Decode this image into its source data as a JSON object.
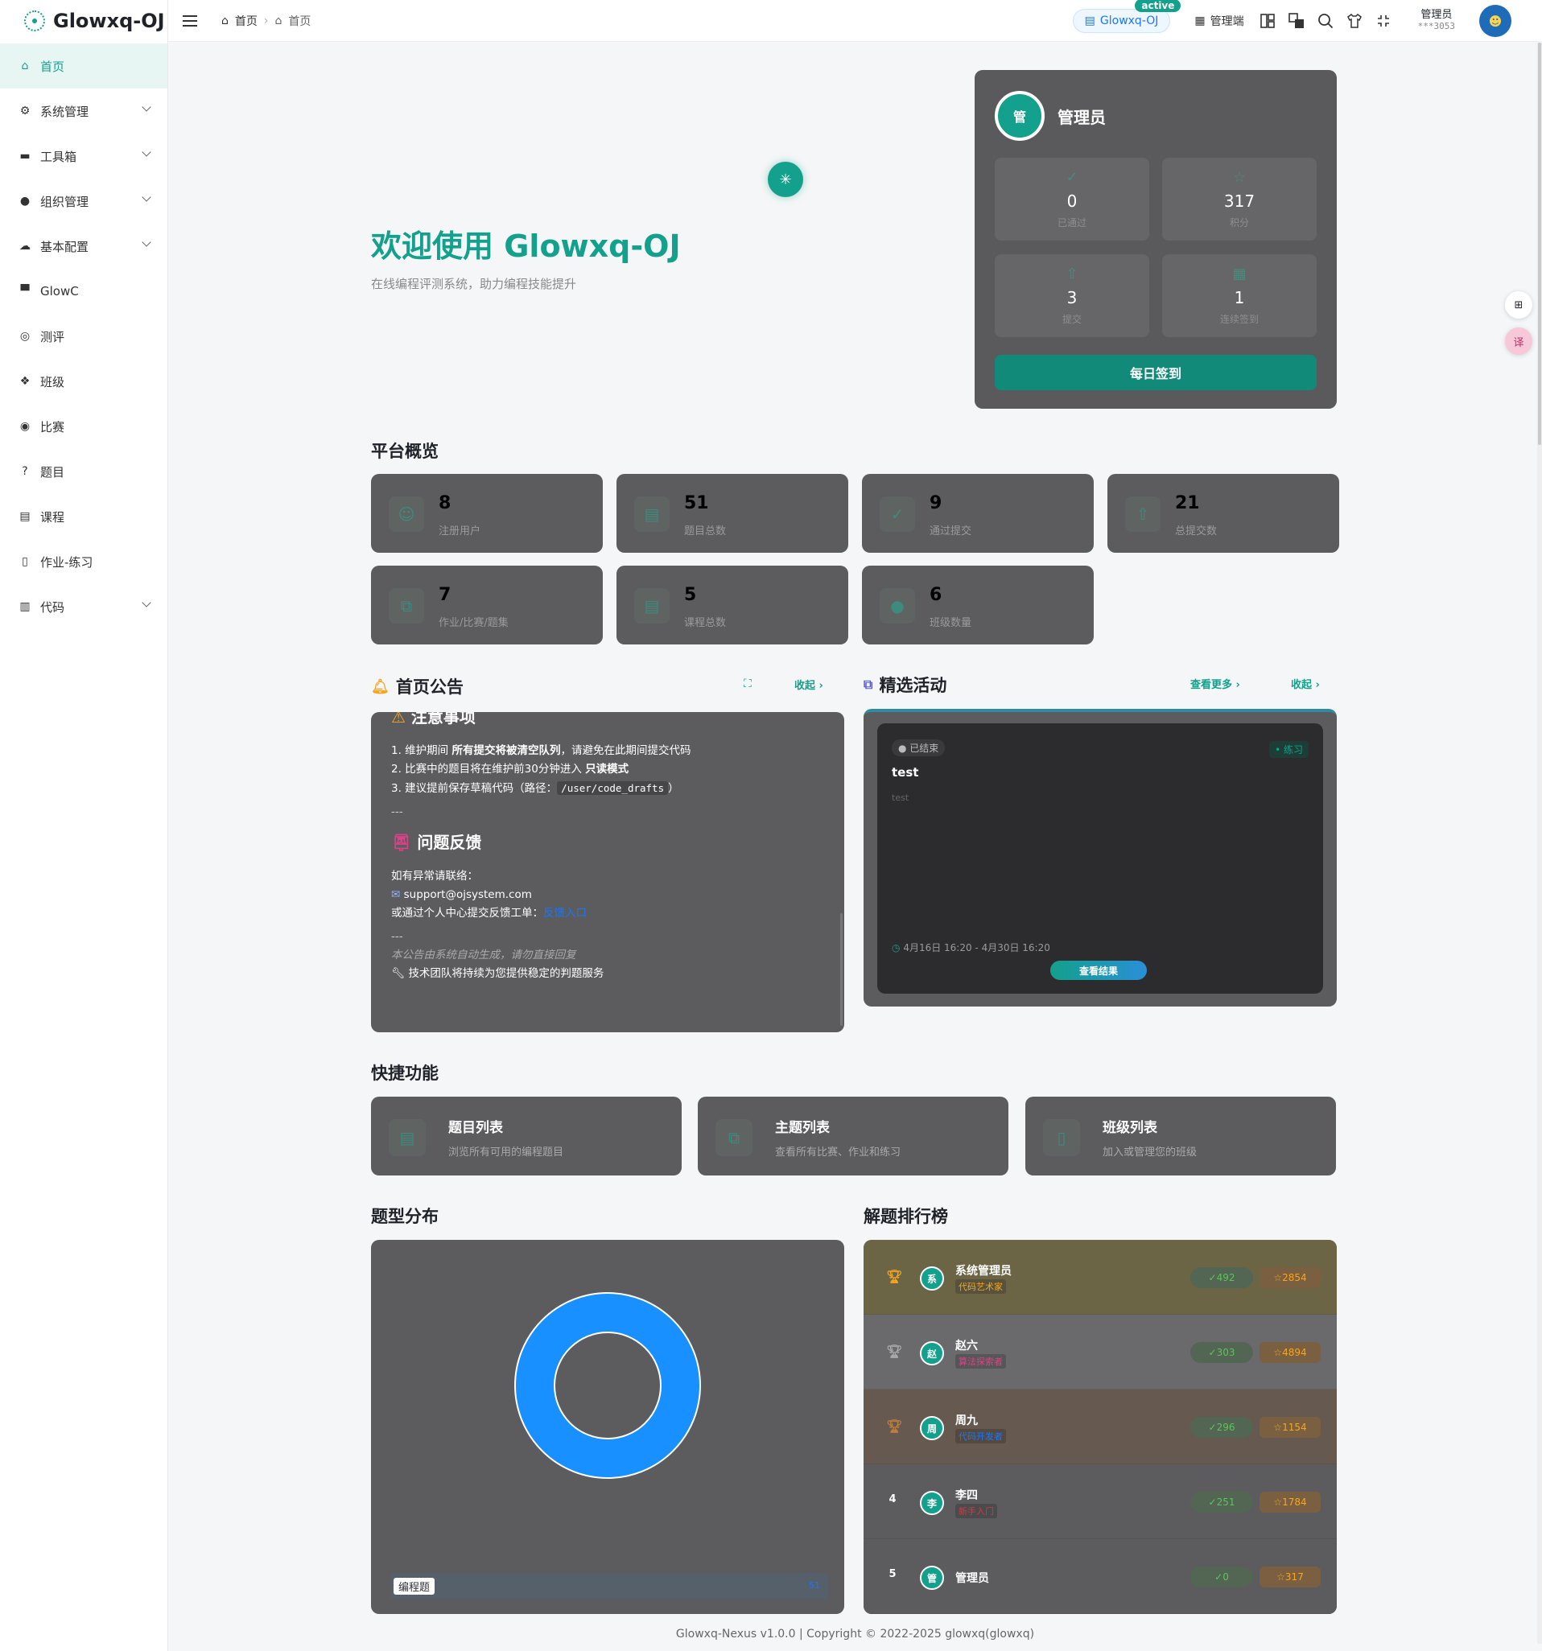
{
  "app": {
    "name": "Glowxq-OJ"
  },
  "sidebar": {
    "items": [
      {
        "label": "首页",
        "icon": "home-icon",
        "active": true
      },
      {
        "label": "系统管理",
        "icon": "gear-icon",
        "expandable": true
      },
      {
        "label": "工具箱",
        "icon": "toolbox-icon",
        "expandable": true
      },
      {
        "label": "组织管理",
        "icon": "user-icon",
        "expandable": true
      },
      {
        "label": "基本配置",
        "icon": "cloud-icon",
        "expandable": true
      },
      {
        "label": "GlowC",
        "icon": "monitor-icon"
      },
      {
        "label": "测评",
        "icon": "target-icon"
      },
      {
        "label": "班级",
        "icon": "group-icon"
      },
      {
        "label": "比赛",
        "icon": "medal-icon"
      },
      {
        "label": "题目",
        "icon": "question-icon"
      },
      {
        "label": "课程",
        "icon": "book-icon"
      },
      {
        "label": "作业-练习",
        "icon": "document-icon"
      },
      {
        "label": "代码",
        "icon": "bucket-icon",
        "expandable": true
      }
    ]
  },
  "topbar": {
    "breadcrumb": [
      "首页",
      "首页"
    ],
    "tenant": "Glowxq-OJ",
    "tenant_badge": "active",
    "admin_label": "管理端",
    "user_name": "管理员",
    "user_sub": "***3053"
  },
  "hero": {
    "title": "欢迎使用 Glowxq-OJ",
    "subtitle": "在线编程评测系统，助力编程技能提升"
  },
  "profile": {
    "name": "管理员",
    "avatar_char": "管",
    "stats": [
      {
        "value": "0",
        "label": "已通过"
      },
      {
        "value": "317",
        "label": "积分"
      },
      {
        "value": "3",
        "label": "提交"
      },
      {
        "value": "1",
        "label": "连续签到"
      }
    ],
    "signin_label": "每日签到"
  },
  "overview": {
    "title": "平台概览",
    "stats": [
      {
        "value": "8",
        "label": "注册用户"
      },
      {
        "value": "51",
        "label": "题目总数"
      },
      {
        "value": "9",
        "label": "通过提交"
      },
      {
        "value": "21",
        "label": "总提交数"
      },
      {
        "value": "7",
        "label": "作业/比赛/题集"
      },
      {
        "value": "5",
        "label": "课程总数"
      },
      {
        "value": "6",
        "label": "班级数量"
      }
    ]
  },
  "notice": {
    "title": "首页公告",
    "collapse_label": "收起",
    "h_warn": "注意事项",
    "items": [
      {
        "pre": "1. 维护期间 ",
        "bold": "所有提交将被清空队列",
        "post": "，请避免在此期间提交代码"
      },
      {
        "pre": "2. 比赛中的题目将在维护前30分钟进入 ",
        "bold": "只读模式",
        "post": ""
      },
      {
        "pre": "3. 建议提前保存草稿代码（路径：",
        "code": "/user/code_drafts",
        "post": "）"
      }
    ],
    "divider": "---",
    "h_feedback": "问题反馈",
    "contact_intro": "如有异常请联络：",
    "email": "support@ojsystem.com",
    "ticket_pre": "或通过个人中心提交反馈工单：",
    "ticket_link": "反馈入口",
    "footer_note": "本公告由系统自动生成，请勿直接回复",
    "team_note": "技术团队将持续为您提供稳定的判题服务"
  },
  "activity": {
    "title": "精选活动",
    "more_label": "查看更多",
    "collapse_label": "收起",
    "status": "已结束",
    "type_tag": "练习",
    "name": "test",
    "desc": "test",
    "time": "4月16日 16:20 - 4月30日 16:20",
    "button": "查看结果"
  },
  "quick": {
    "title": "快捷功能",
    "items": [
      {
        "title": "题目列表",
        "desc": "浏览所有可用的编程题目"
      },
      {
        "title": "主题列表",
        "desc": "查看所有比赛、作业和练习"
      },
      {
        "title": "班级列表",
        "desc": "加入或管理您的班级"
      }
    ]
  },
  "chart_data": {
    "type": "pie",
    "title": "题型分布",
    "donut": true,
    "categories": [
      "编程题"
    ],
    "values": [
      51
    ],
    "colors": [
      "#1890ff"
    ]
  },
  "ranking": {
    "title": "解题排行榜",
    "rows": [
      {
        "rank": "1",
        "name": "系统管理员",
        "char": "系",
        "badge": "代码艺术家",
        "passed": "492",
        "score": "2854",
        "bg": "#6b6546",
        "badge_color": "#f5a623"
      },
      {
        "rank": "2",
        "name": "赵六",
        "char": "赵",
        "badge": "算法探索者",
        "passed": "303",
        "score": "4894",
        "bg": "#6a6a6c",
        "badge_color": "#e0408a"
      },
      {
        "rank": "3",
        "name": "周九",
        "char": "周",
        "badge": "代码开发者",
        "passed": "296",
        "score": "1154",
        "bg": "#665a50",
        "badge_color": "#1677ff"
      },
      {
        "rank": "4",
        "name": "李四",
        "char": "李",
        "badge": "新手入门",
        "passed": "251",
        "score": "1784",
        "bg": "#5c5c5e",
        "badge_color": "#d9363e"
      },
      {
        "rank": "5",
        "name": "管理员",
        "char": "管",
        "badge": "",
        "passed": "0",
        "score": "317",
        "bg": "#5c5c5e",
        "badge_color": ""
      }
    ]
  },
  "footer": "Glowxq-Nexus v1.0.0 | Copyright © 2022-2025 glowxq(glowxq)"
}
